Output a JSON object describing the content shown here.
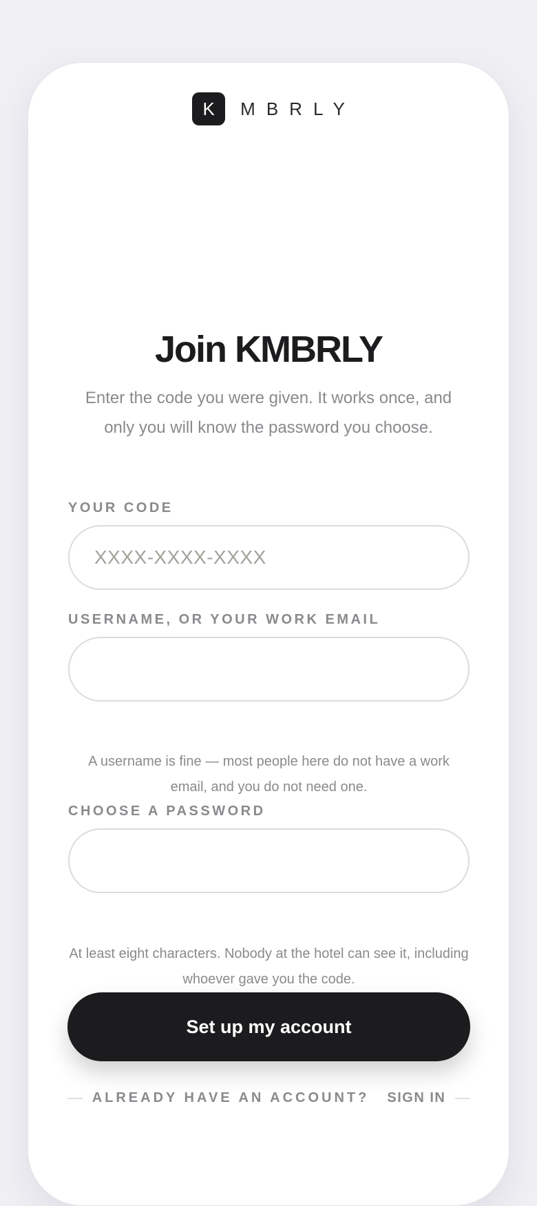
{
  "brand": {
    "mark": "K",
    "wordmark": "MBRLY"
  },
  "header": {
    "title": "Join KMBRLY",
    "subtitle": "Enter the code you were given. It works once, and only you will know the password you choose."
  },
  "form": {
    "code": {
      "label": "YOUR CODE",
      "placeholder": "XXXX-XXXX-XXXX",
      "value": ""
    },
    "username": {
      "label": "USERNAME, OR YOUR WORK EMAIL",
      "placeholder": "",
      "value": "",
      "hint": "A username is fine — most people here do not have a work email, and you do not need one."
    },
    "password": {
      "label": "CHOOSE A PASSWORD",
      "placeholder": "",
      "value": "",
      "hint": "At least eight characters. Nobody at the hotel can see it, including whoever gave you the code."
    },
    "submit_label": "Set up my account"
  },
  "footer": {
    "prompt": "ALREADY HAVE AN ACCOUNT?",
    "signin_label": "SIGN IN"
  },
  "colors": {
    "background": "#efeff4",
    "card": "#ffffff",
    "primary": "#1c1c1e",
    "muted_text": "#8a8a8e",
    "field_border": "#dcdcde"
  }
}
